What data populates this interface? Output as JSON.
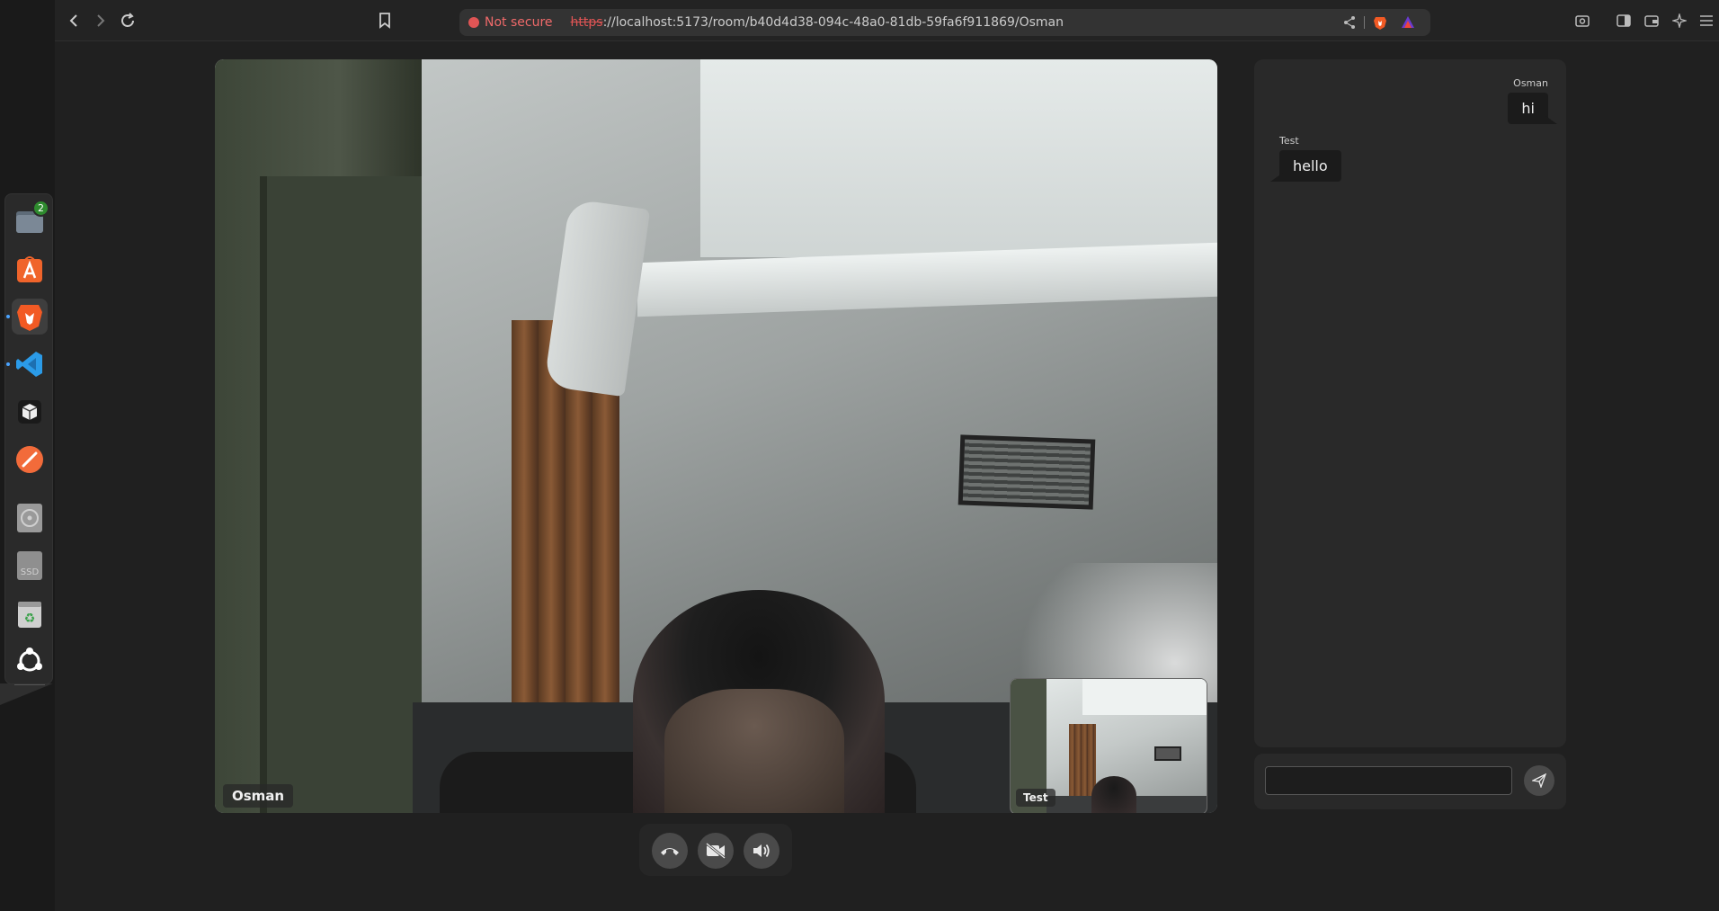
{
  "browser": {
    "security_label": "Not secure",
    "url_protocol": "https",
    "url_rest": "://localhost:5173/room/b40d4d38-094c-48a0-81db-59fa6f911869/Osman"
  },
  "dock": {
    "items": [
      {
        "name": "files",
        "icon": "folder-icon",
        "badge": "2"
      },
      {
        "name": "app-center",
        "icon": "app-center-icon"
      },
      {
        "name": "brave",
        "icon": "brave-lion-icon",
        "active": true
      },
      {
        "name": "vscode",
        "icon": "vscode-icon"
      },
      {
        "name": "box-app",
        "icon": "box-icon"
      },
      {
        "name": "postman",
        "icon": "postman-icon"
      },
      {
        "name": "disc",
        "icon": "disc-icon"
      },
      {
        "name": "ssd",
        "icon": "ssd-icon",
        "label": "SSD"
      },
      {
        "name": "trash",
        "icon": "trash-icon"
      },
      {
        "name": "ubuntu",
        "icon": "ubuntu-icon"
      }
    ]
  },
  "call": {
    "remote_name": "Osman",
    "local_name": "Test"
  },
  "chat": {
    "messages": [
      {
        "sender": "Osman",
        "text": "hi",
        "side": "right"
      },
      {
        "sender": "Test",
        "text": "hello",
        "side": "left"
      }
    ],
    "input_value": ""
  },
  "colors": {
    "background": "#202020",
    "panel": "#292929",
    "bubble": "#1b1b1b",
    "insecure": "#e05555",
    "brave": "#f25a24",
    "vscode": "#2b9be8"
  }
}
